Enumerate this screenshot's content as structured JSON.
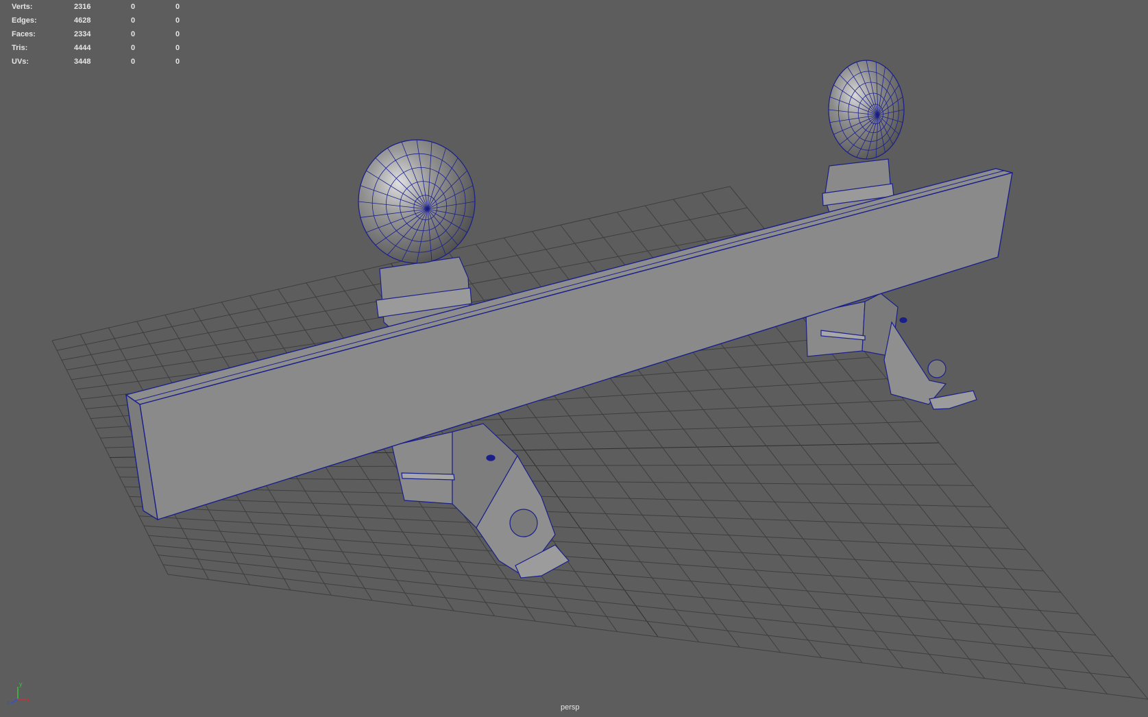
{
  "hud": {
    "rows": [
      {
        "label": "Verts:",
        "v1": "2316",
        "v2": "0",
        "v3": "0"
      },
      {
        "label": "Edges:",
        "v1": "4628",
        "v2": "0",
        "v3": "0"
      },
      {
        "label": "Faces:",
        "v1": "2334",
        "v2": "0",
        "v3": "0"
      },
      {
        "label": "Tris:",
        "v1": "4444",
        "v2": "0",
        "v3": "0"
      },
      {
        "label": "UVs:",
        "v1": "3448",
        "v2": "0",
        "v3": "0"
      }
    ]
  },
  "viewport": {
    "camera": "persp",
    "background_color": "#5d5d5d",
    "grid_color": "#3e3e3e",
    "wire_color": "#1a1f8a",
    "axis": {
      "y": "y",
      "x": "x",
      "z": "z",
      "x_color": "#d03030",
      "y_color": "#40c040",
      "z_color": "#3050e0"
    }
  }
}
